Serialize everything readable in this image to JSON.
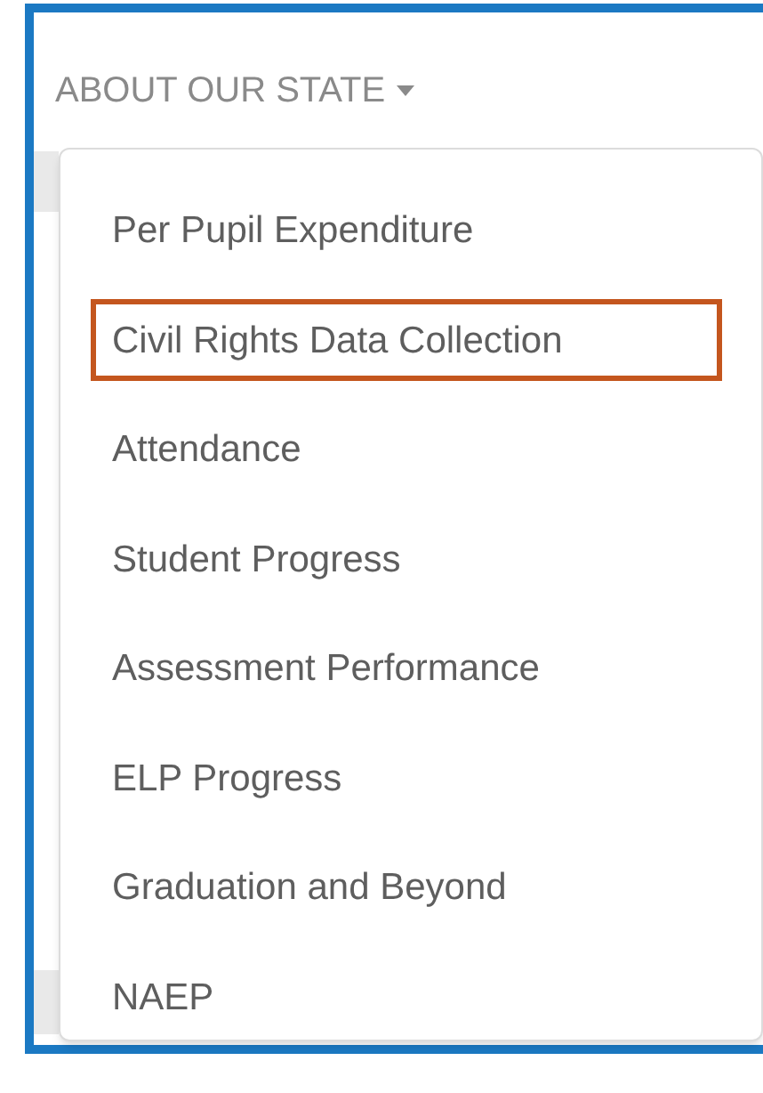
{
  "menu_button": {
    "label": "ABOUT OUR STATE",
    "expanded": true
  },
  "menu_items": [
    {
      "label": "Per Pupil Expenditure",
      "highlighted": false
    },
    {
      "label": "Civil Rights Data Collection",
      "highlighted": true
    },
    {
      "label": "Attendance",
      "highlighted": false
    },
    {
      "label": "Student Progress",
      "highlighted": false
    },
    {
      "label": "Assessment Performance",
      "highlighted": false
    },
    {
      "label": "ELP Progress",
      "highlighted": false
    },
    {
      "label": "Graduation and Beyond",
      "highlighted": false
    },
    {
      "label": "NAEP",
      "highlighted": false
    }
  ]
}
